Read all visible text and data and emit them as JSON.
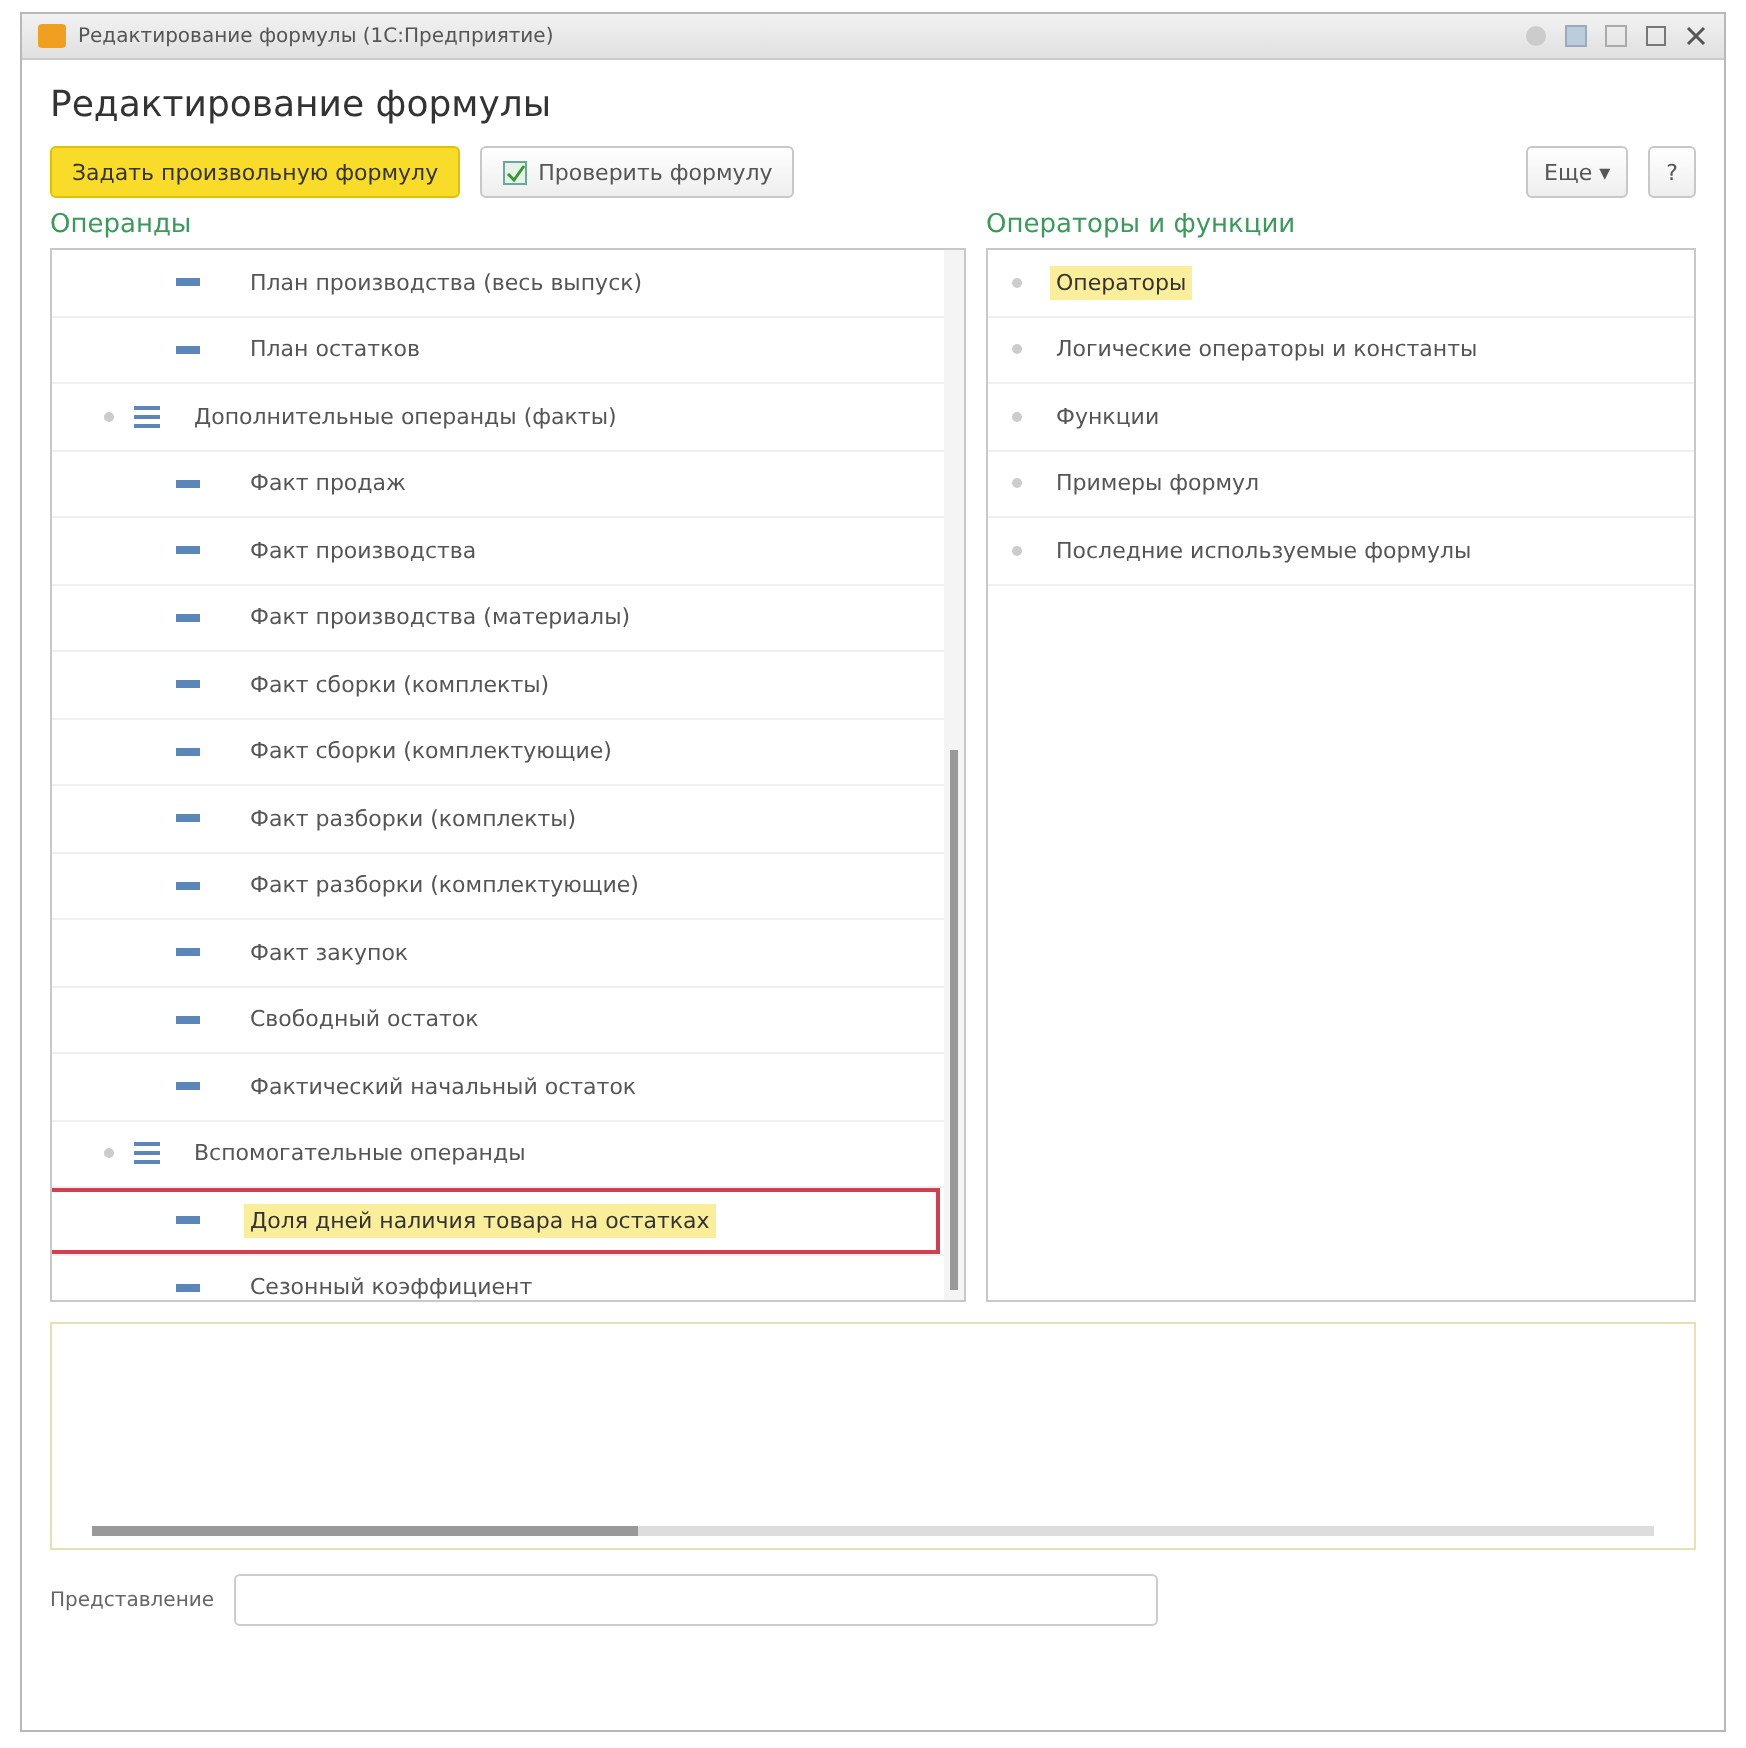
{
  "window": {
    "title": "Редактирование формулы (1С:Предприятие)"
  },
  "form_title": "Редактирование формулы",
  "toolbar": {
    "buttons": [
      {
        "label": "Задать произвольную формулу",
        "kind": "primary"
      },
      {
        "label": "Проверить формулу",
        "kind": "check"
      }
    ],
    "right_buttons": [
      {
        "label": "Еще ▾"
      },
      {
        "label": "?"
      }
    ]
  },
  "operands": {
    "title": "Операнды",
    "items": [
      {
        "label": "План производства (весь выпуск)",
        "kind": "leaf",
        "selected": false
      },
      {
        "label": "План остатков",
        "kind": "leaf",
        "selected": false
      },
      {
        "label": "Дополнительные операнды (факты)",
        "kind": "group",
        "selected": false,
        "children": [
          {
            "label": "Факт продаж",
            "kind": "leaf",
            "selected": false
          },
          {
            "label": "Факт производства",
            "kind": "leaf",
            "selected": false
          },
          {
            "label": "Факт производства (материалы)",
            "kind": "leaf",
            "selected": false
          },
          {
            "label": "Факт сборки (комплекты)",
            "kind": "leaf",
            "selected": false
          },
          {
            "label": "Факт сборки (комплектующие)",
            "kind": "leaf",
            "selected": false
          },
          {
            "label": "Факт разборки (комплекты)",
            "kind": "leaf",
            "selected": false
          },
          {
            "label": "Факт разборки (комплектующие)",
            "kind": "leaf",
            "selected": false
          },
          {
            "label": "Факт закупок",
            "kind": "leaf",
            "selected": false
          },
          {
            "label": "Свободный остаток",
            "kind": "leaf",
            "selected": false
          },
          {
            "label": "Фактический начальный остаток",
            "kind": "leaf",
            "selected": false
          }
        ]
      },
      {
        "label": "Вспомогательные операнды",
        "kind": "group",
        "selected": false,
        "children": [
          {
            "label": "Доля дней наличия товара на остатках",
            "kind": "leaf",
            "selected": true,
            "highlighted": true
          },
          {
            "label": "Сезонный коэффициент",
            "kind": "leaf",
            "selected": false,
            "highlighted": false
          }
        ]
      }
    ]
  },
  "operators": {
    "title": "Операторы и функции",
    "items": [
      {
        "label": "Операторы",
        "selected": true
      },
      {
        "label": "Логические операторы и константы",
        "selected": false
      },
      {
        "label": "Функции",
        "selected": false
      },
      {
        "label": "Примеры формул",
        "selected": false
      },
      {
        "label": "Последние используемые формулы",
        "selected": false
      }
    ]
  },
  "representation": {
    "label": "Представление"
  }
}
